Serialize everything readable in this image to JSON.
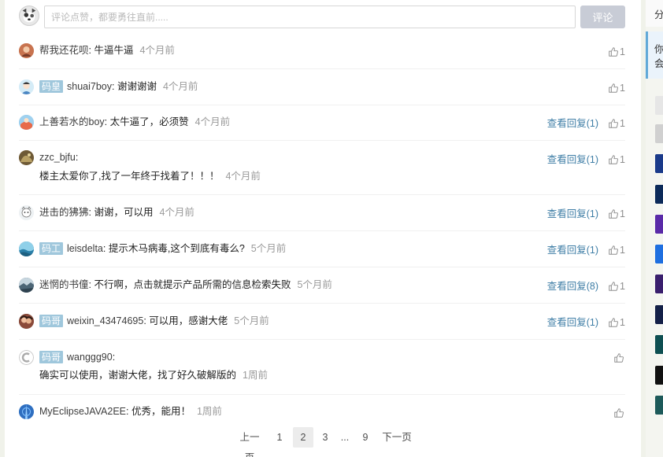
{
  "composer": {
    "placeholder": "评论点赞，都要勇往直前.....",
    "submit_label": "评论"
  },
  "comments": [
    {
      "user": "帮我还花呗",
      "badge": "",
      "text": "牛逼牛逼",
      "time": "4个月前",
      "replies": "",
      "likes": "1"
    },
    {
      "user": "shuai7boy",
      "badge": "码皇",
      "text": "谢谢谢谢",
      "time": "4个月前",
      "replies": "",
      "likes": "1"
    },
    {
      "user": "上善若水的boy",
      "badge": "",
      "text": "太牛逼了，必须赞",
      "time": "4个月前",
      "replies": "查看回复(1)",
      "likes": "1"
    },
    {
      "user": "zzc_bjfu",
      "badge": "",
      "text": "楼主太爱你了,找了一年终于找着了！！！",
      "time": "4个月前",
      "replies": "查看回复(1)",
      "likes": "1"
    },
    {
      "user": "进击的狒狒",
      "badge": "",
      "text": "谢谢，可以用",
      "time": "4个月前",
      "replies": "查看回复(1)",
      "likes": "1"
    },
    {
      "user": "leisdelta",
      "badge": "码工",
      "text": "提示木马病毒,这个到底有毒么?",
      "time": "5个月前",
      "replies": "查看回复(1)",
      "likes": "1"
    },
    {
      "user": "迷惘的书僮",
      "badge": "",
      "text": "不行啊，点击就提示产品所需的信息检索失败",
      "time": "5个月前",
      "replies": "查看回复(8)",
      "likes": "1"
    },
    {
      "user": "weixin_43474695",
      "badge": "码哥",
      "text": "可以用，感谢大佬",
      "time": "5个月前",
      "replies": "查看回复(1)",
      "likes": "1"
    },
    {
      "user": "wanggg90",
      "badge": "码哥",
      "text": "确实可以使用，谢谢大佬，找了好久破解版的",
      "time": "1周前",
      "replies": "",
      "likes": ""
    },
    {
      "user": "MyEclipseJAVA2EE",
      "badge": "",
      "text": "优秀，能用！",
      "time": "1周前",
      "replies": "",
      "likes": ""
    }
  ],
  "pagination": {
    "prev": "上一页",
    "pages": [
      "1",
      "2",
      "3",
      "...",
      "9"
    ],
    "current": "2",
    "next": "下一页"
  },
  "sidebar": {
    "heading_partial": "分",
    "notice_partial_1": "你",
    "notice_partial_2": "会",
    "accent": "#61a9d8"
  },
  "colors": {
    "link": "#3f7ea6",
    "badge": "#9fc7dc",
    "submit_disabled": "#c8ccd6"
  }
}
